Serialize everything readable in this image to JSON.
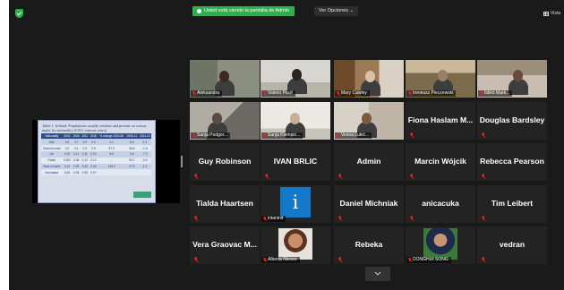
{
  "header": {
    "viewing_banner": "Usted está viendo la pantalla de Admin",
    "view_options": "Ver Opciones ⌄",
    "layout_button": "Vista"
  },
  "colors": {
    "background": "#1a1a1a",
    "banner_green": "#2bb24c",
    "active_speaker": "#c8d94a",
    "mute_red": "#e0242c",
    "avatar_blue": "#1479c8"
  },
  "shared_screen": {
    "slide_title": "Table 1. Ireland: Populations usually resident and present on census night, by nationality (CSO, various years)",
    "columns": [
      "Nationality",
      "2002",
      "2006",
      "2011",
      "2016",
      "% change 2002-06",
      "2006-11",
      "2011-16"
    ],
    "rows": [
      [
        "Irish",
        "3.6",
        "3.7",
        "3.9",
        "3.9",
        "4.1",
        "5.6",
        "0.4"
      ],
      [
        "Total non-Irish",
        "0.2",
        "0.4",
        "0.5",
        "0.5",
        "87.0",
        "28.6",
        "-1.6"
      ],
      [
        "UK",
        "0.10",
        "0.11",
        "0.11",
        "0.10",
        "8.6",
        "0.6",
        "-7.2"
      ],
      [
        "Polish",
        "0.002",
        "0.06",
        "0.12",
        "0.12",
        "-",
        "93.7",
        "-0.3"
      ],
      [
        "Rest of world",
        "0.10",
        "0.25",
        "0.32",
        "0.34",
        "145.2",
        "27.5",
        "4.4"
      ],
      [
        "Not stated",
        "0.05",
        "0.05",
        "0.05",
        "0.07",
        "",
        "",
        ""
      ]
    ]
  },
  "participants": [
    {
      "name": "Aleksandra",
      "type": "video"
    },
    {
      "name": "Valerio Paull",
      "type": "video"
    },
    {
      "name": "Mary Cawley",
      "type": "video",
      "active": true
    },
    {
      "name": "Ireneusz Pieczewski",
      "type": "video"
    },
    {
      "name": "Ildikó Mark...",
      "type": "video"
    },
    {
      "name": "Sanja Podgor...",
      "type": "video"
    },
    {
      "name": "Sanja Klempić...",
      "type": "video"
    },
    {
      "name": "Vesna Lukić...",
      "type": "video"
    },
    {
      "name": "Fiona Haslam M...",
      "type": "name"
    },
    {
      "name": "Douglas Bardsley",
      "type": "name"
    },
    {
      "name": "Guy Robinson",
      "type": "name"
    },
    {
      "name": "IVAN BRLIC",
      "type": "name"
    },
    {
      "name": "Admin",
      "type": "name"
    },
    {
      "name": "Marcin Wójcik",
      "type": "name"
    },
    {
      "name": "Rebecca Pearson",
      "type": "name"
    },
    {
      "name": "Tialda Haartsen",
      "type": "name"
    },
    {
      "name": "intaninit",
      "type": "avatar"
    },
    {
      "name": "Daniel Michniak",
      "type": "name"
    },
    {
      "name": "anicacuka",
      "type": "name"
    },
    {
      "name": "Tim Leibert",
      "type": "name"
    },
    {
      "name": "Vera Graovac M...",
      "type": "name"
    },
    {
      "name": "Alberta Nieves",
      "type": "photo"
    },
    {
      "name": "Rebeka",
      "type": "name"
    },
    {
      "name": "DONGHUI SONG",
      "type": "photo"
    },
    {
      "name": "vedran",
      "type": "name"
    }
  ],
  "icons": [
    "shield-icon",
    "grid-icon",
    "mic-muted-icon",
    "chevron-down-icon"
  ]
}
